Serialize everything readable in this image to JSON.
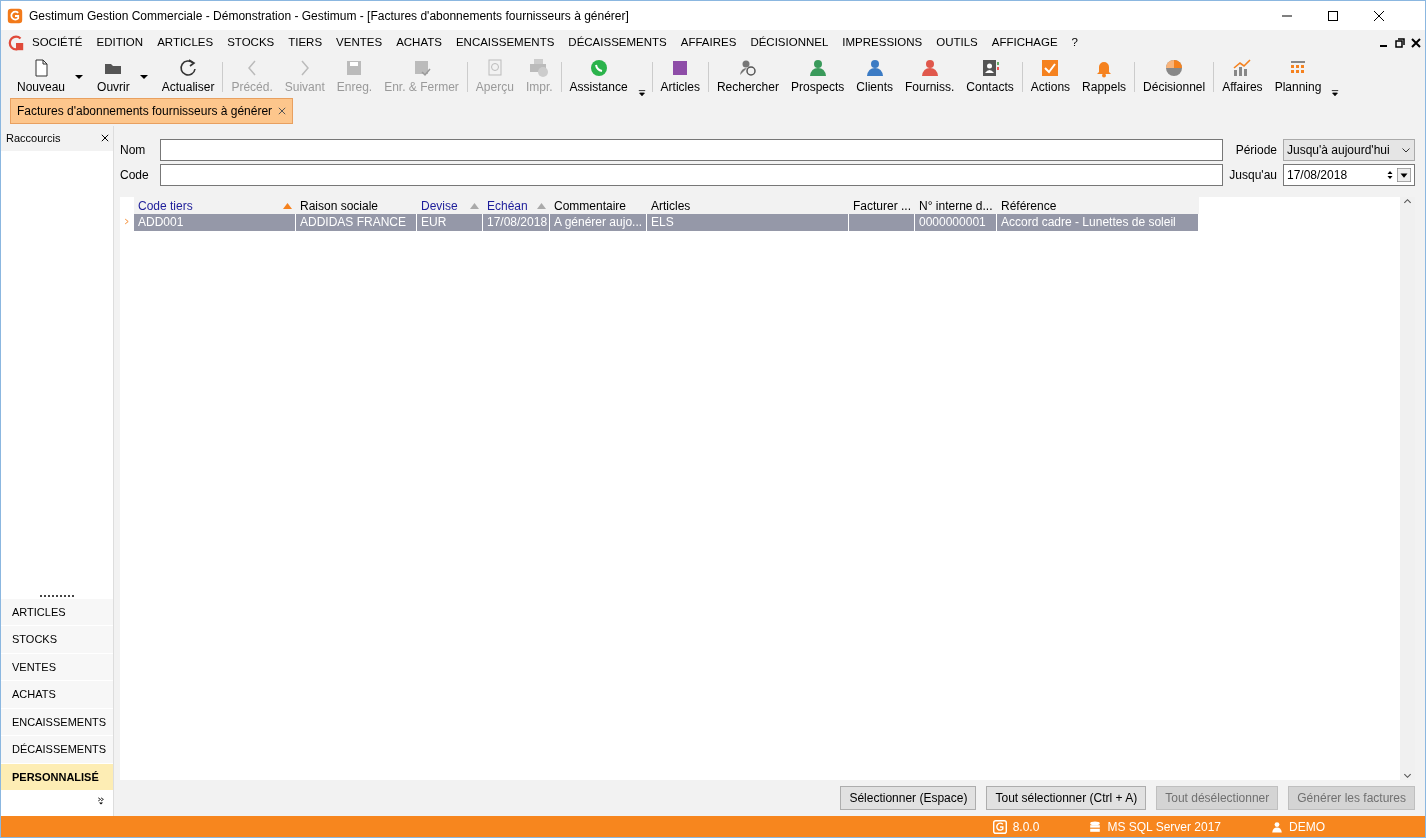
{
  "window": {
    "title": "Gestimum Gestion Commerciale - Démonstration - Gestimum - [Factures d'abonnements fournisseurs à générer]"
  },
  "menu": [
    "SOCIÉTÉ",
    "EDITION",
    "ARTICLES",
    "STOCKS",
    "TIERS",
    "VENTES",
    "ACHATS",
    "ENCAISSEMENTS",
    "DÉCAISSEMENTS",
    "AFFAIRES",
    "DÉCISIONNEL",
    "IMPRESSIONS",
    "OUTILS",
    "AFFICHAGE",
    "?"
  ],
  "toolbar": [
    {
      "kind": "new",
      "label": "Nouveau",
      "disabled": false,
      "dropdown": true
    },
    {
      "kind": "open",
      "label": "Ouvrir",
      "disabled": false,
      "dropdown": true
    },
    {
      "kind": "refresh",
      "label": "Actualiser",
      "disabled": false,
      "dropdown": false
    },
    {
      "kind": "sep"
    },
    {
      "kind": "prev",
      "label": "Précéd.",
      "disabled": true,
      "dropdown": false
    },
    {
      "kind": "next",
      "label": "Suivant",
      "disabled": true,
      "dropdown": false
    },
    {
      "kind": "save",
      "label": "Enreg.",
      "disabled": true,
      "dropdown": false
    },
    {
      "kind": "saveclose",
      "label": "Enr. & Fermer",
      "disabled": true,
      "dropdown": false
    },
    {
      "kind": "sep"
    },
    {
      "kind": "preview",
      "label": "Aperçu",
      "disabled": true,
      "dropdown": false
    },
    {
      "kind": "print",
      "label": "Impr.",
      "disabled": true,
      "dropdown": false
    },
    {
      "kind": "sep"
    },
    {
      "kind": "chat",
      "label": "Assistance",
      "disabled": false,
      "dropdown": false
    },
    {
      "kind": "more"
    },
    {
      "kind": "sep"
    },
    {
      "kind": "square",
      "label": "Articles",
      "disabled": false,
      "dropdown": false
    },
    {
      "kind": "sep"
    },
    {
      "kind": "search",
      "label": "Rechercher",
      "disabled": false,
      "dropdown": false
    },
    {
      "kind": "person",
      "label": "Prospects",
      "disabled": false,
      "dropdown": false,
      "color": "#3a9a5b"
    },
    {
      "kind": "person",
      "label": "Clients",
      "disabled": false,
      "dropdown": false,
      "color": "#3b7bc4"
    },
    {
      "kind": "person",
      "label": "Fourniss.",
      "disabled": false,
      "dropdown": false,
      "color": "#e0584c"
    },
    {
      "kind": "contacts",
      "label": "Contacts",
      "disabled": false,
      "dropdown": false
    },
    {
      "kind": "sep"
    },
    {
      "kind": "check",
      "label": "Actions",
      "disabled": false,
      "dropdown": false
    },
    {
      "kind": "bell",
      "label": "Rappels",
      "disabled": false,
      "dropdown": false
    },
    {
      "kind": "sep"
    },
    {
      "kind": "pie",
      "label": "Décisionnel",
      "disabled": false,
      "dropdown": false
    },
    {
      "kind": "sep"
    },
    {
      "kind": "chart",
      "label": "Affaires",
      "disabled": false,
      "dropdown": false
    },
    {
      "kind": "calendar",
      "label": "Planning",
      "disabled": false,
      "dropdown": false
    },
    {
      "kind": "more"
    }
  ],
  "document_tab": {
    "label": "Factures d'abonnements fournisseurs à générer"
  },
  "sidebar": {
    "title": "Raccourcis",
    "items": [
      {
        "label": "ARTICLES",
        "selected": false
      },
      {
        "label": "STOCKS",
        "selected": false
      },
      {
        "label": "VENTES",
        "selected": false
      },
      {
        "label": "ACHATS",
        "selected": false
      },
      {
        "label": "ENCAISSEMENTS",
        "selected": false
      },
      {
        "label": "DÉCAISSEMENTS",
        "selected": false
      },
      {
        "label": "PERSONNALISÉ",
        "selected": true
      }
    ]
  },
  "filters": {
    "nom_label": "Nom",
    "code_label": "Code",
    "periode_label": "Période",
    "periode_value": "Jusqu'à aujourd'hui",
    "jusquau_label": "Jusqu'au",
    "jusquau_value": "17/08/2018"
  },
  "table": {
    "columns": [
      {
        "label": "Code tiers",
        "sort_arrow": true,
        "color": "#f5821f"
      },
      {
        "label": "Raison sociale",
        "sort_arrow": false
      },
      {
        "label": "Devise",
        "sort_arrow": true,
        "color": "#aaaaaa"
      },
      {
        "label": "Echéan",
        "sort_arrow": true,
        "color": "#aaaaaa"
      },
      {
        "label": "Commentaire",
        "sort_arrow": false
      },
      {
        "label": "Articles",
        "sort_arrow": false
      },
      {
        "label": "Facturer ...",
        "sort_arrow": false
      },
      {
        "label": "N° interne d...",
        "sort_arrow": false
      },
      {
        "label": "Référence",
        "sort_arrow": false
      }
    ],
    "rows": [
      {
        "selected": true,
        "cells": [
          "ADD001",
          "ADDIDAS FRANCE",
          "EUR",
          "17/08/2018",
          "A générer aujo...",
          "ELS",
          "",
          "0000000001",
          "Accord cadre - Lunettes de soleil"
        ]
      }
    ]
  },
  "buttons": [
    {
      "label": "Sélectionner (Espace)",
      "disabled": false
    },
    {
      "label": "Tout sélectionner (Ctrl + A)",
      "disabled": false
    },
    {
      "label": "Tout désélectionner",
      "disabled": true
    },
    {
      "label": "Générer les factures",
      "disabled": true
    }
  ],
  "status_bar": {
    "version": "8.0.0",
    "database": "MS SQL Server 2017",
    "user": "DEMO"
  }
}
